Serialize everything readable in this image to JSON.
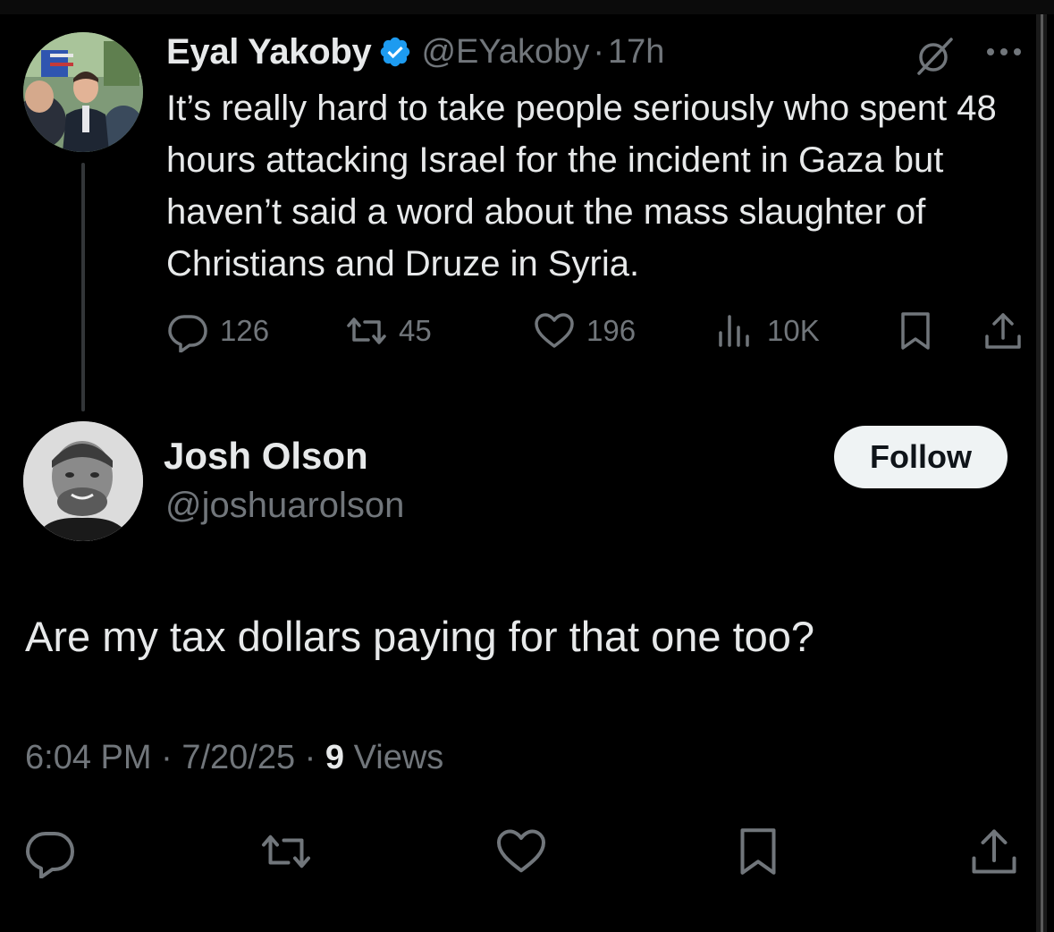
{
  "tweet1": {
    "author_name": "Eyal Yakoby",
    "handle": "@EYakoby",
    "separator": "·",
    "time": "17h",
    "text": "It’s really hard to take people seriously who spent 48 hours attacking Israel for the incident in Gaza but haven’t said a word about the mass slaughter of Christians and Druze in Syria.",
    "replies": "126",
    "retweets": "45",
    "likes": "196",
    "views": "10K",
    "icons": [
      "verified-badge-icon",
      "grok-icon",
      "more-icon",
      "reply-icon",
      "retweet-icon",
      "like-icon",
      "views-icon",
      "bookmark-icon",
      "share-icon"
    ]
  },
  "tweet2": {
    "author_name": "Josh Olson",
    "handle": "@joshuarolson",
    "follow_label": "Follow",
    "text": "Are my tax dollars paying for that one too?",
    "time": "6:04 PM",
    "date": "7/20/25",
    "separator": "·",
    "views_count": "9",
    "views_label": "Views",
    "icons": [
      "reply-icon",
      "retweet-icon",
      "like-icon",
      "bookmark-icon",
      "share-icon"
    ]
  },
  "colors": {
    "background": "#000000",
    "text_primary": "#e7e9ea",
    "text_secondary": "#71767b",
    "verified_blue": "#1d9bf0",
    "follow_bg": "#eff3f4",
    "thread_line": "#333639"
  }
}
